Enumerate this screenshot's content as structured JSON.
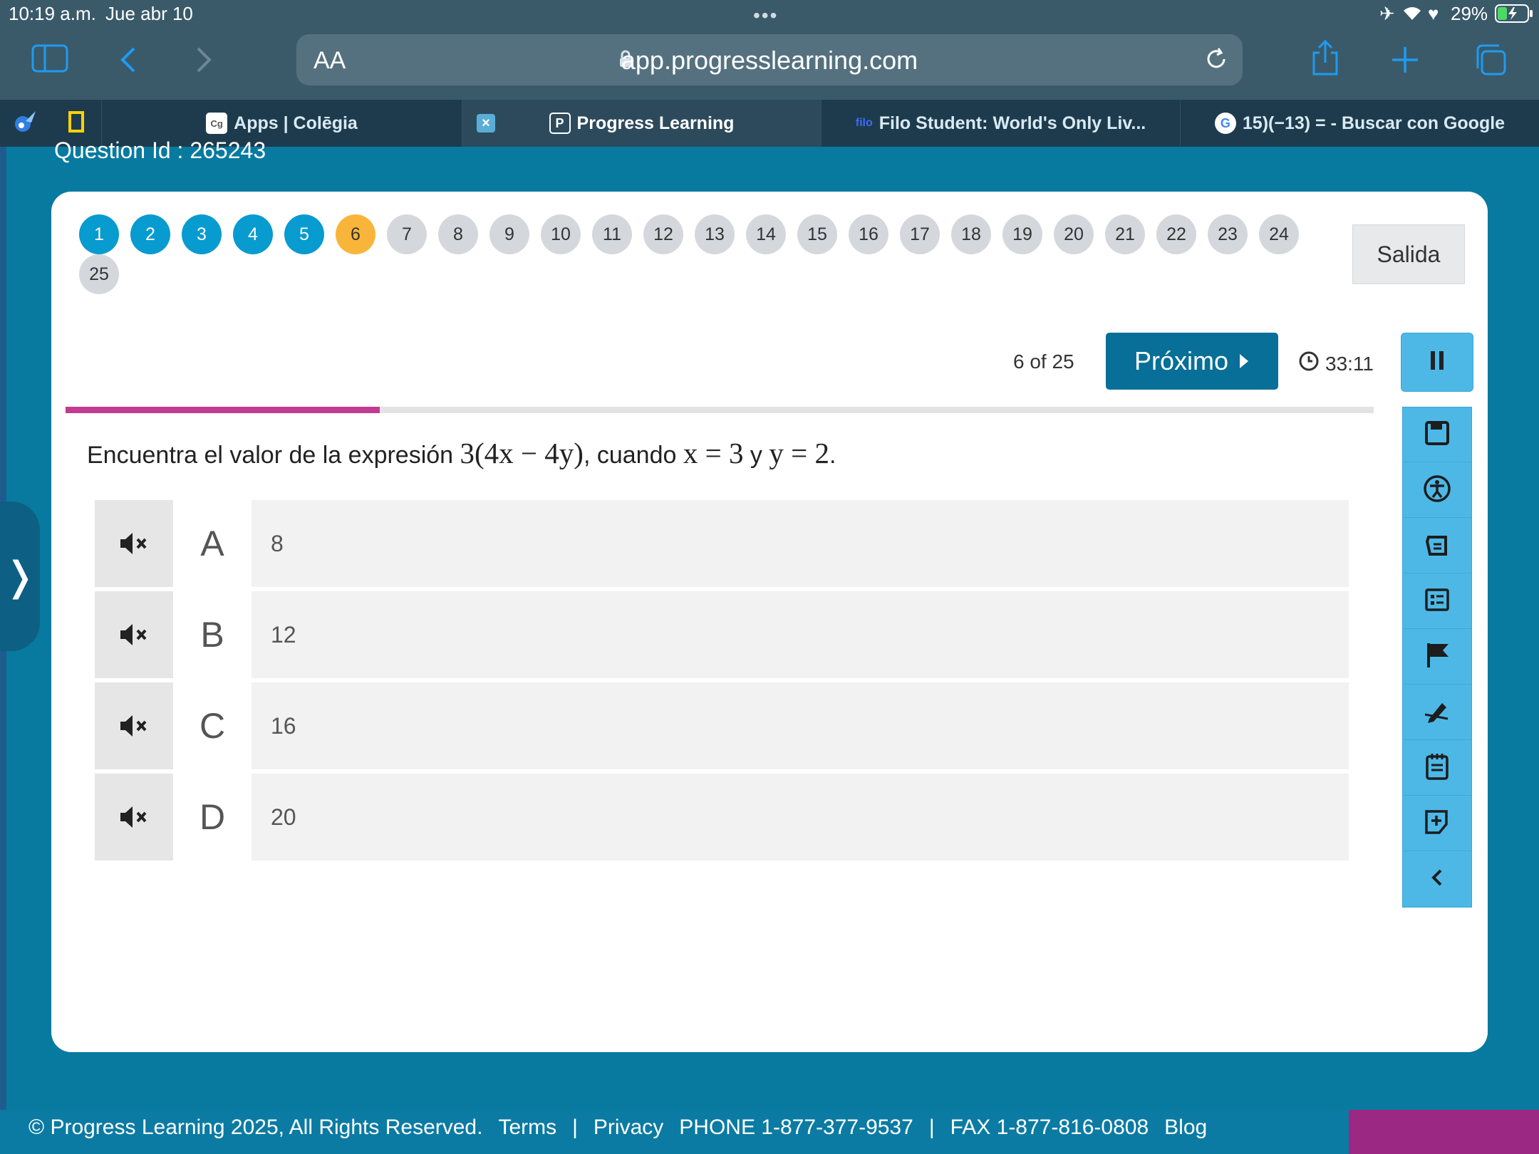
{
  "status_bar": {
    "time": "10:19 a.m.",
    "date": "Jue abr 10",
    "battery": "29%"
  },
  "browser": {
    "reader_label": "AA",
    "url": "app.progresslearning.com",
    "tabs": [
      {
        "label": "Apps | Colēgia",
        "favicon": "colegia-icon",
        "active": false
      },
      {
        "label": "Progress Learning",
        "favicon": "P",
        "active": true
      },
      {
        "label": "Filo Student: World's Only Liv...",
        "favicon": "filo",
        "active": false
      },
      {
        "label": "15)(−13) = - Buscar con Google",
        "favicon": "G",
        "active": false
      }
    ]
  },
  "page": {
    "question_id": "Question Id : 265243",
    "question_numbers": [
      "1",
      "2",
      "3",
      "4",
      "5",
      "6",
      "7",
      "8",
      "9",
      "10",
      "11",
      "12",
      "13",
      "14",
      "15",
      "16",
      "17",
      "18",
      "19",
      "20",
      "21",
      "22",
      "23",
      "24",
      "25"
    ],
    "answered_count": 5,
    "current_question": 6,
    "exit_label": "Salida",
    "counter": "6 of 25",
    "next_label": "Próximo",
    "timer": "33:11",
    "progress_fraction": 0.24,
    "question": {
      "text_before": "Encuentra el valor de la expresión ",
      "expr": "3(4x − 4y)",
      "text_mid": ", cuando ",
      "x_assign": "x = 3",
      "text_y": " y ",
      "y_assign": "y = 2",
      "text_end": "."
    },
    "answers": [
      {
        "letter": "A",
        "value": "8"
      },
      {
        "letter": "B",
        "value": "12"
      },
      {
        "letter": "C",
        "value": "16"
      },
      {
        "letter": "D",
        "value": "20"
      }
    ],
    "tools": [
      "save-icon",
      "accessibility-icon",
      "eraser-icon",
      "answer-key-icon",
      "flag-icon",
      "strike-pen-icon",
      "notepad-icon",
      "add-note-icon",
      "collapse-icon"
    ]
  },
  "footer": {
    "copyright": "© Progress Learning 2025, All Rights Reserved.",
    "terms": "Terms",
    "sep1": "|",
    "privacy": "Privacy",
    "phone": "PHONE 1-877-377-9537",
    "sep2": "|",
    "fax": "FAX 1-877-816-0808",
    "blog": "Blog"
  },
  "colors": {
    "accent": "#076f98",
    "answered": "#079bd0",
    "current": "#f9b53a",
    "progress": "#c13b91",
    "tools": "#4db8e6"
  }
}
